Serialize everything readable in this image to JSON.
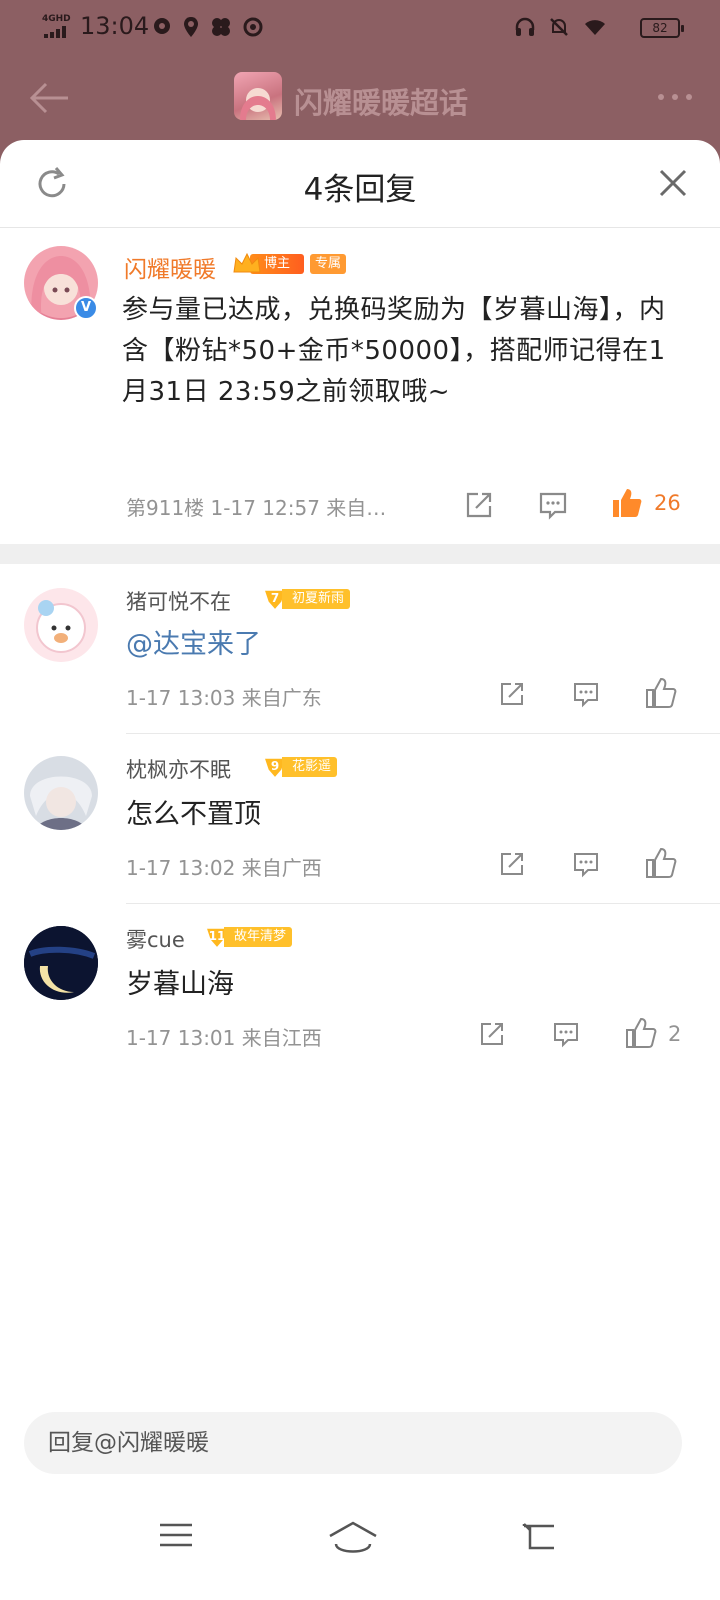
{
  "status_bar": {
    "network": "4GHD",
    "time": "13:04",
    "battery": "82"
  },
  "background_page": {
    "title": "闪耀暖暖超话"
  },
  "sheet": {
    "title": "4条回复"
  },
  "main_post": {
    "author": "闪耀暖暖",
    "role_badge": "博主",
    "exclusive_tag": "专属",
    "content": "参与量已达成，兑换码奖励为【岁暮山海】，内含【粉钻*50+金币*50000】，搭配师记得在1月31日 23:59之前领取哦~",
    "meta": "第911楼 1-17 12:57 来自…",
    "like_count": "26",
    "verified_mark": "V"
  },
  "replies": [
    {
      "author": "猪可悦不在",
      "level": "7",
      "badge": "初夏新雨",
      "text": "@达宝来了",
      "meta": "1-17 13:03 来自广东",
      "like_count": ""
    },
    {
      "author": "枕枫亦不眠",
      "level": "9",
      "badge": "花影遥",
      "text": "怎么不置顶",
      "meta": "1-17 13:02 来自广西",
      "like_count": ""
    },
    {
      "author": "雾cue",
      "level": "11",
      "badge": "故年清梦",
      "text": "岁暮山海",
      "meta": "1-17 13:01 来自江西",
      "like_count": "2"
    }
  ],
  "reply_input": {
    "placeholder": "回复@闪耀暖暖"
  },
  "colors": {
    "accent_orange": "#f07a2a",
    "mention_blue": "#4a7ab0",
    "level_gold": "#ffc02b",
    "dim_overlay": "#8c5f63"
  }
}
